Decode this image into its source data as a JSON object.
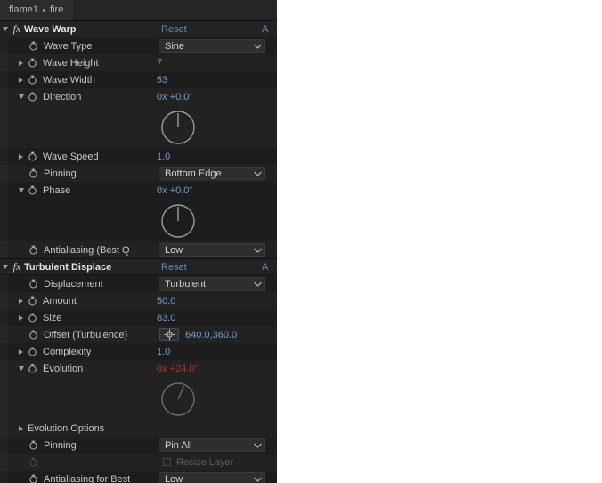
{
  "panel": {
    "tab": {
      "comp": "flame1",
      "separator": "•",
      "layer": "fire"
    },
    "links": {
      "reset": "Reset",
      "about": "A"
    }
  },
  "effects": [
    {
      "name": "Wave Warp",
      "properties": [
        {
          "label": "Wave Type",
          "type": "dropdown",
          "value": "Sine"
        },
        {
          "label": "Wave Height",
          "type": "number",
          "value": "7"
        },
        {
          "label": "Wave Width",
          "type": "number",
          "value": "53"
        },
        {
          "label": "Direction",
          "type": "angle",
          "value": "0x +0.0",
          "degrees": 0
        },
        {
          "label": "Wave Speed",
          "type": "number",
          "value": "1.0"
        },
        {
          "label": "Pinning",
          "type": "dropdown",
          "value": "Bottom Edge"
        },
        {
          "label": "Phase",
          "type": "angle",
          "value": "0x +0.0",
          "degrees": 0
        },
        {
          "label": "Antialiasing (Best Q",
          "type": "dropdown",
          "value": "Low"
        }
      ]
    },
    {
      "name": "Turbulent Displace",
      "properties": [
        {
          "label": "Displacement",
          "type": "dropdown",
          "value": "Turbulent"
        },
        {
          "label": "Amount",
          "type": "number",
          "value": "50.0"
        },
        {
          "label": "Size",
          "type": "number",
          "value": "83.0"
        },
        {
          "label": "Offset (Turbulence)",
          "type": "point",
          "value": "640.0,360.0"
        },
        {
          "label": "Complexity",
          "type": "number",
          "value": "1.0"
        },
        {
          "label": "Evolution",
          "type": "angle",
          "value": "0x +24.0",
          "degrees": 24,
          "animated": true
        },
        {
          "label": "Evolution Options",
          "type": "group"
        },
        {
          "label": "Pinning",
          "type": "dropdown",
          "value": "Pin All"
        },
        {
          "label": "Resize Layer",
          "type": "checkbox",
          "checked": false,
          "disabled": true
        },
        {
          "label": "Antialiasing for Best",
          "type": "dropdown",
          "value": "Low"
        }
      ]
    }
  ],
  "colors": {
    "panel_bg": "#1d1d1d",
    "row_alt": "#222222",
    "value_blue": "#6c9fd6",
    "value_animated_red": "#b0322f",
    "link_blue": "#5f8fc4",
    "label": "#c8c8c8"
  },
  "icons": {
    "stopwatch": "stopwatch-icon",
    "fx": "fx-icon",
    "chevron": "chevron-down-icon",
    "crosshair": "crosshair-icon",
    "triangle": "disclosure-triangle-icon"
  }
}
